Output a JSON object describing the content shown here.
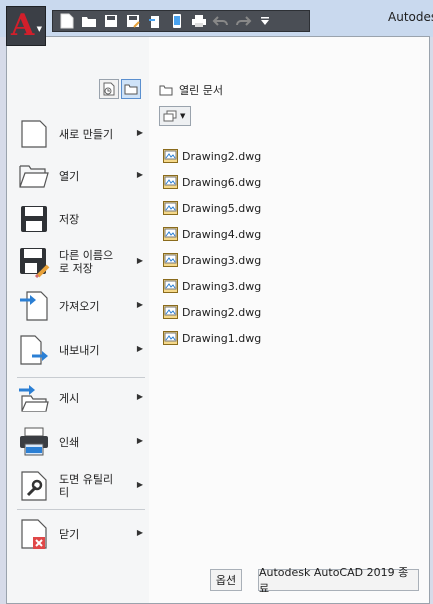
{
  "window": {
    "title": "Autodes"
  },
  "search": {
    "placeholder": "",
    "value": ""
  },
  "left_menu": [
    {
      "label": "새로 만들기",
      "has_arrow": true,
      "icon": "new-document-icon"
    },
    {
      "label": "열기",
      "has_arrow": true,
      "icon": "open-folder-icon"
    },
    {
      "label": "저장",
      "has_arrow": false,
      "icon": "save-icon"
    },
    {
      "label": "다른 이름으\n로 저장",
      "has_arrow": true,
      "icon": "save-as-icon"
    },
    {
      "label": "가져오기",
      "has_arrow": true,
      "icon": "import-icon"
    },
    {
      "label": "내보내기",
      "has_arrow": true,
      "icon": "export-icon"
    },
    {
      "label": "게시",
      "has_arrow": true,
      "icon": "publish-icon"
    },
    {
      "label": "인쇄",
      "has_arrow": true,
      "icon": "print-icon"
    },
    {
      "label": "도면 유틸리\n티",
      "has_arrow": true,
      "icon": "drawing-utilities-icon"
    },
    {
      "label": "닫기",
      "has_arrow": true,
      "icon": "close-document-icon"
    }
  ],
  "right_pane": {
    "heading": "열린 문서",
    "documents": [
      "Drawing2.dwg",
      "Drawing6.dwg",
      "Drawing5.dwg",
      "Drawing4.dwg",
      "Drawing3.dwg",
      "Drawing3.dwg",
      "Drawing2.dwg",
      "Drawing1.dwg"
    ]
  },
  "footer": {
    "options_label": "옵션",
    "exit_label": "Autodesk AutoCAD 2019 종료"
  },
  "colors": {
    "accent": "#2b7fd4",
    "app_logo": "#d21f2b",
    "dark_bar": "#4a4e55"
  }
}
